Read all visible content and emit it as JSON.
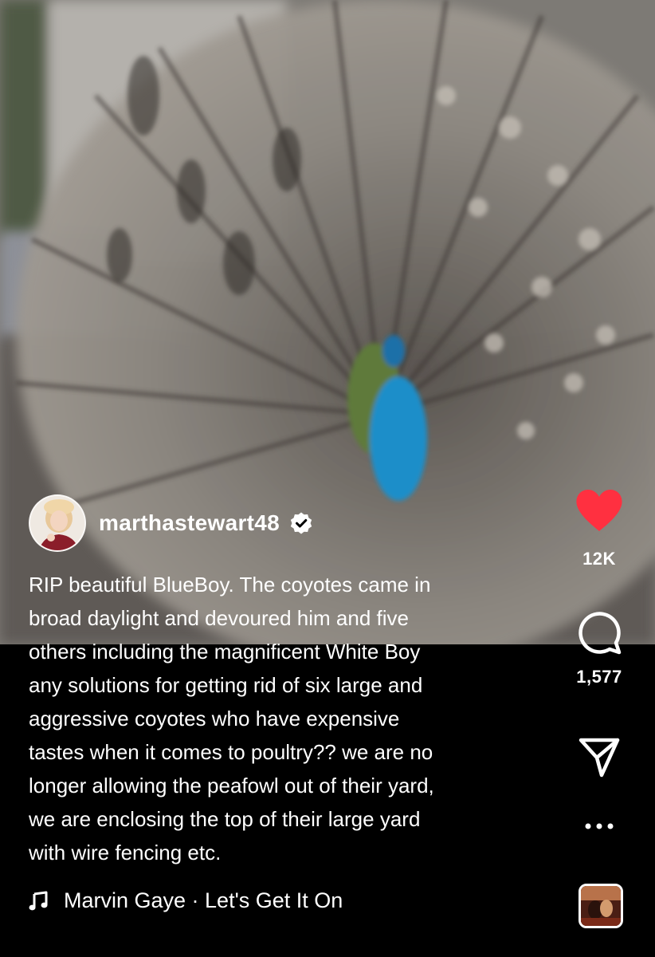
{
  "post": {
    "username": "marthastewart48",
    "verified": true,
    "caption": "RIP beautiful BlueBoy. The coyotes came in\nbroad daylight and devoured him and five\nothers including  the magnificent White Boy\nany solutions for getting rid of six large and\naggressive coyotes  who have expensive\ntastes when it comes to poultry?? we are no\nlonger allowing the peafowl out of their yard,\nwe are enclosing the top of their large yard\nwith wire fencing etc.",
    "music": {
      "icon": "music-note-icon",
      "artist_track": "Marvin Gaye · Let's Get It On"
    }
  },
  "actions": {
    "like": {
      "icon": "heart-icon",
      "count": "12K",
      "liked": true,
      "color": "#ff3040"
    },
    "comment": {
      "icon": "comment-icon",
      "count": "1,577"
    },
    "share": {
      "icon": "paper-plane-icon"
    },
    "more": {
      "icon": "more-dots-icon"
    }
  },
  "colors": {
    "background": "#000000",
    "text": "#ffffff",
    "like_red": "#ff3040",
    "verified_blue": "#ffffff"
  }
}
